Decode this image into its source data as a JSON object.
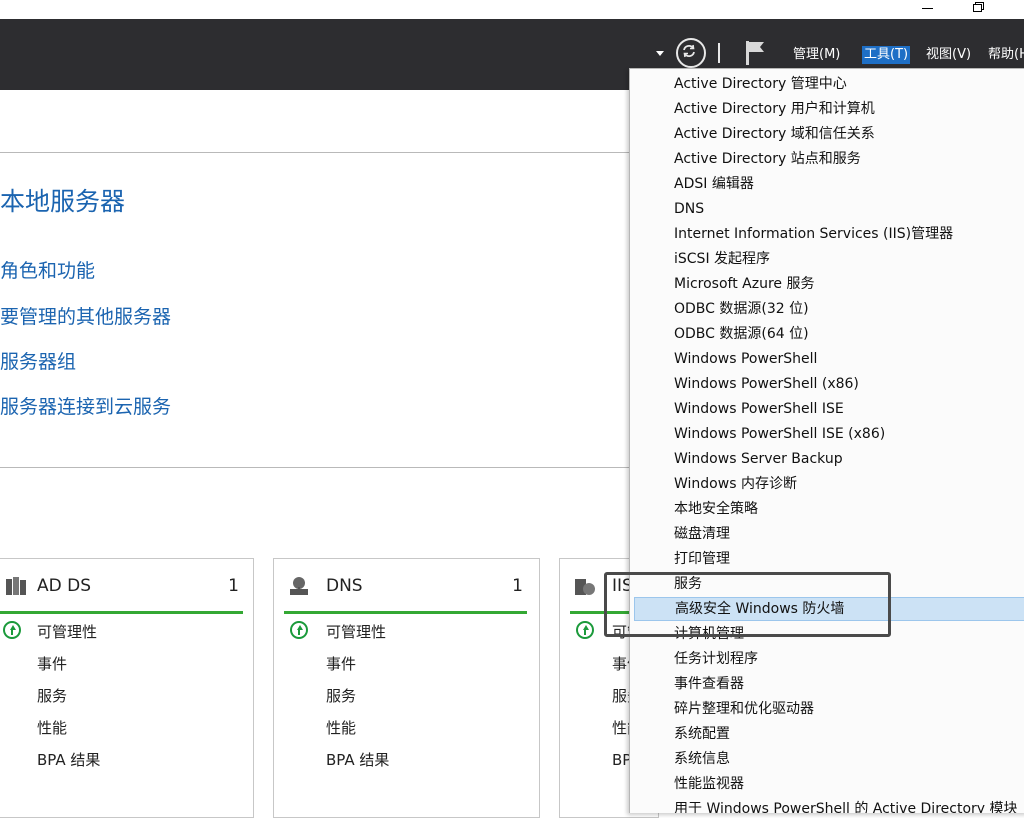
{
  "window": {
    "minimize_icon": "minimize-icon",
    "restore_icon": "restore-icon"
  },
  "toolbar": {
    "menus": [
      {
        "label": "管理(M)"
      },
      {
        "label": "工具(T)",
        "active": true
      },
      {
        "label": "视图(V)"
      },
      {
        "label": "帮助(H"
      }
    ],
    "icons": [
      "dropdown-arrow-icon",
      "refresh-icon",
      "flag-icon"
    ]
  },
  "content": {
    "title": "本地服务器",
    "quick_links": [
      {
        "label": "角色和功能"
      },
      {
        "label": "要管理的其他服务器"
      },
      {
        "label": "服务器组"
      },
      {
        "label": "服务器连接到云服务"
      }
    ]
  },
  "tiles": [
    {
      "name": "AD DS",
      "count": "1",
      "icon": "ad-ds-icon",
      "rows": [
        "可管理性",
        "事件",
        "服务",
        "性能",
        "BPA 结果"
      ]
    },
    {
      "name": "DNS",
      "count": "1",
      "icon": "dns-icon",
      "rows": [
        "可管理性",
        "事件",
        "服务",
        "性能",
        "BPA 结果"
      ]
    },
    {
      "name": "IIS",
      "count": "",
      "icon": "iis-icon",
      "rows": [
        "可管理性",
        "事件",
        "服务",
        "性能",
        "BPA 结果"
      ]
    }
  ],
  "tools_menu": {
    "items": [
      "Active Directory 管理中心",
      "Active Directory 用户和计算机",
      "Active Directory 域和信任关系",
      "Active Directory 站点和服务",
      "ADSI 编辑器",
      "DNS",
      "Internet Information Services (IIS)管理器",
      "iSCSI 发起程序",
      "Microsoft Azure 服务",
      "ODBC 数据源(32 位)",
      "ODBC 数据源(64 位)",
      "Windows PowerShell",
      "Windows PowerShell (x86)",
      "Windows PowerShell ISE",
      "Windows PowerShell ISE (x86)",
      "Windows Server Backup",
      "Windows 内存诊断",
      "本地安全策略",
      "磁盘清理",
      "打印管理",
      "服务",
      "高级安全 Windows 防火墙",
      "计算机管理",
      "任务计划程序",
      "事件查看器",
      "碎片整理和优化驱动器",
      "系统配置",
      "系统信息",
      "性能监视器",
      "用于 Windows PowerShell 的 Active Directory 模块"
    ],
    "highlighted_index": 21
  },
  "colors": {
    "toolbar_bg": "#2d2d30",
    "link": "#1b64b0",
    "ok_green": "#34a834",
    "menu_highlight": "#cce2f5"
  }
}
